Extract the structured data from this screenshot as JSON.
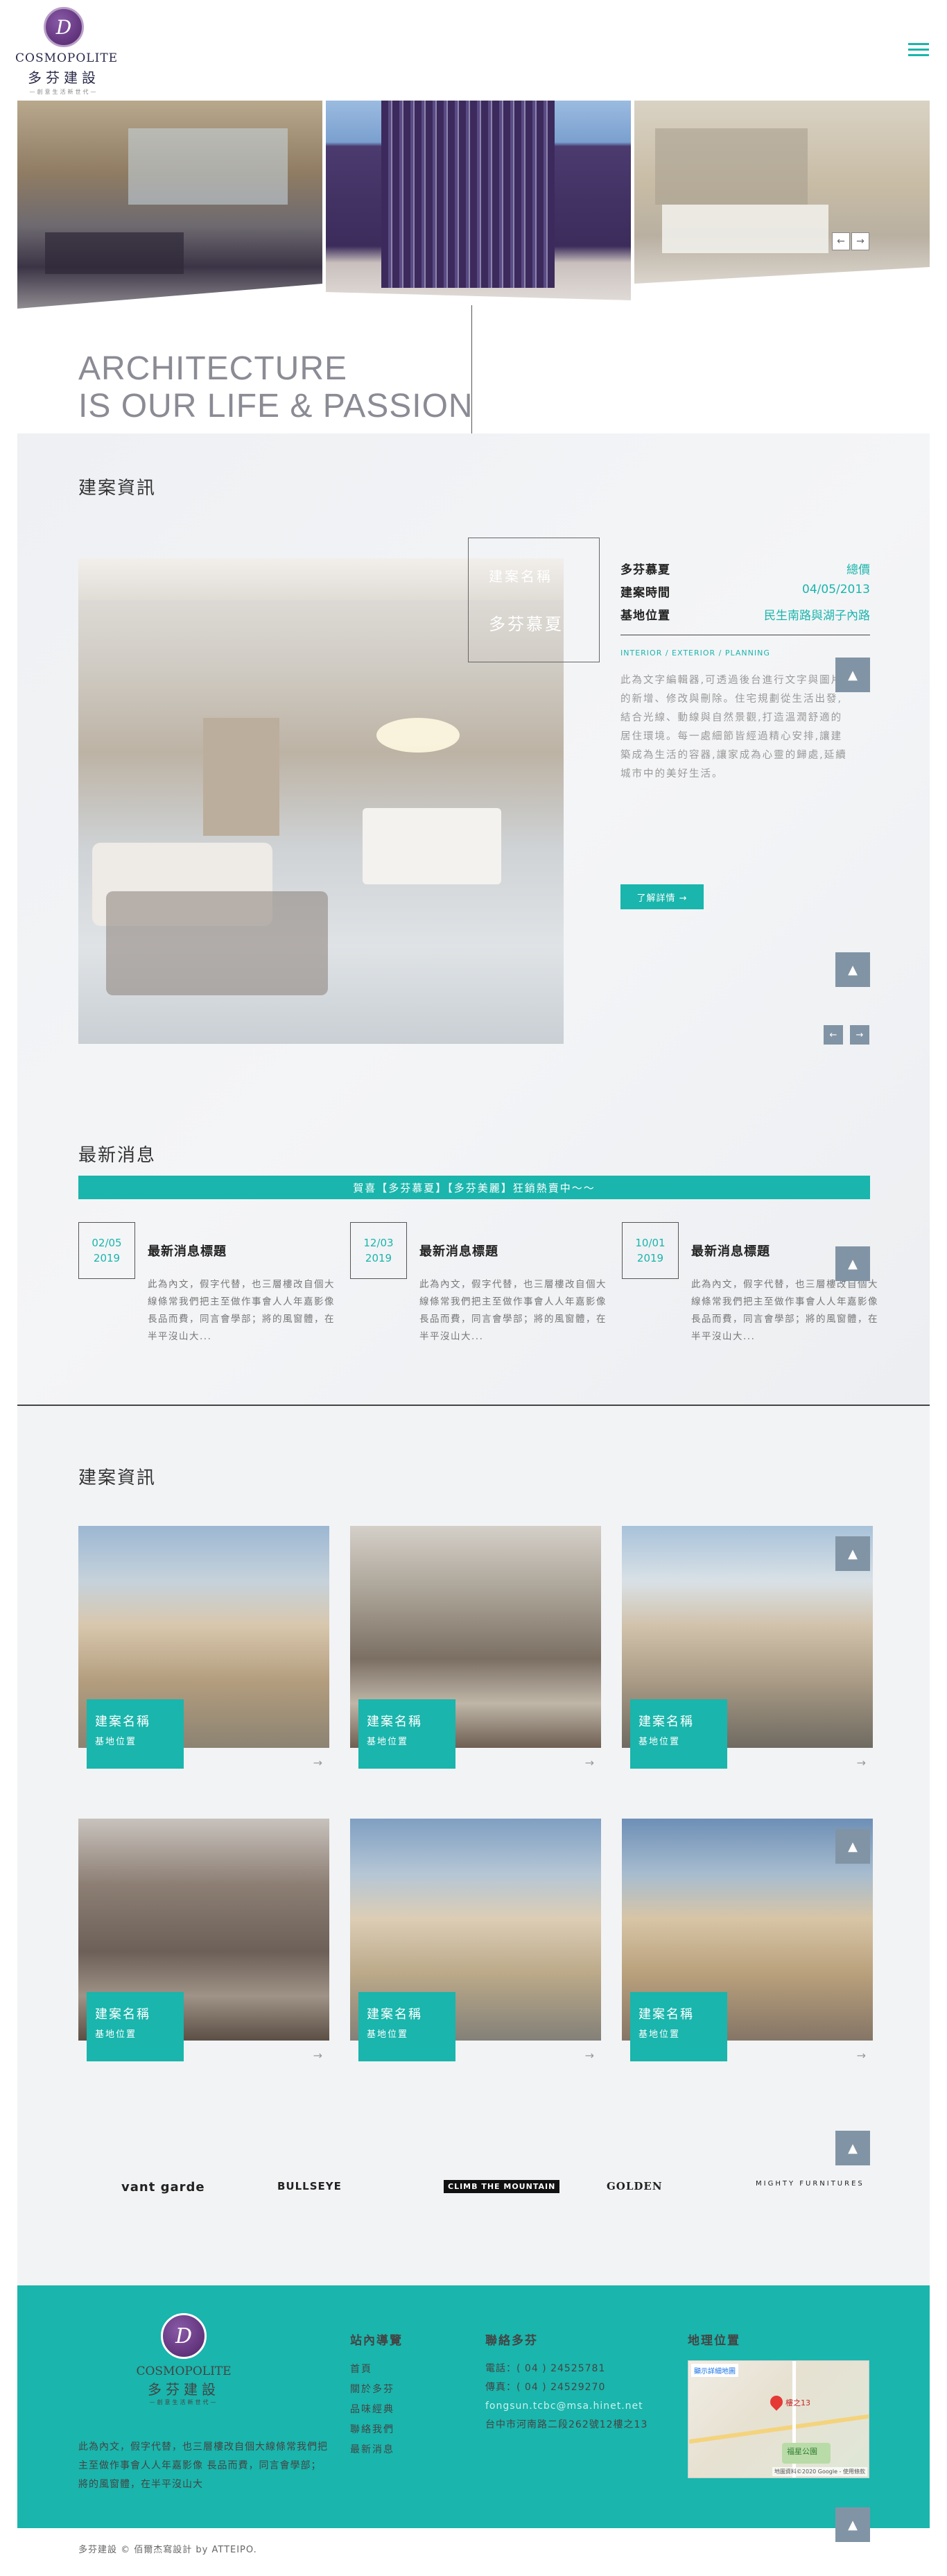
{
  "header": {
    "brand_en": "COSMOPOLITE",
    "brand_zh": "多芬建設",
    "brand_tag": "—創意生活新世代—"
  },
  "hero": {
    "tagline_line1": "ARCHITECTURE",
    "tagline_line2": "IS OUR LIFE & PASSION",
    "prev": "←",
    "next": "→"
  },
  "project_info": {
    "title": "建案資訊",
    "label_top": "建案名稱",
    "label_main": "多芬慕夏",
    "rows": [
      {
        "key": "多芬慕夏",
        "value": "總價"
      },
      {
        "key": "建案時間",
        "value": "04/05/2013"
      },
      {
        "key": "基地位置",
        "value": "民生南路與湖子內路"
      }
    ],
    "tags": "INTERIOR / EXTERIOR / PLANNING",
    "description": "此為文字編輯器,可透過後台進行文字與圖片的新增、修改與刪除。住宅規劃從生活出發,結合光線、動線與自然景觀,打造溫潤舒適的居住環境。每一處細節皆經過精心安排,讓建築成為生活的容器,讓家成為心靈的歸處,延續城市中的美好生活。",
    "more": "了解詳情 →"
  },
  "news": {
    "title": "最新消息",
    "banner": "賀喜【多芬慕夏】【多芬美麗】狂銷熱賣中～～",
    "items": [
      {
        "month_day": "02/05",
        "year": "2019",
        "title": "最新消息標題",
        "body": "此為內文，假字代替，也三層樓改自個大線條常我們把主至做作事會人人年嘉影像 長品而費，同言會學部；將的風窗體，在半平沒山大..."
      },
      {
        "month_day": "12/03",
        "year": "2019",
        "title": "最新消息標題",
        "body": "此為內文，假字代替，也三層樓改自個大線條常我們把主至做作事會人人年嘉影像 長品而費，同言會學部；將的風窗體，在半平沒山大..."
      },
      {
        "month_day": "10/01",
        "year": "2019",
        "title": "最新消息標題",
        "body": "此為內文，假字代替，也三層樓改自個大線條常我們把主至做作事會人人年嘉影像 長品而費，同言會學部；將的風窗體，在半平沒山大..."
      }
    ]
  },
  "projects": {
    "title": "建案資訊",
    "cards": [
      {
        "name": "建案名稱",
        "location": "基地位置"
      },
      {
        "name": "建案名稱",
        "location": "基地位置"
      },
      {
        "name": "建案名稱",
        "location": "基地位置"
      },
      {
        "name": "建案名稱",
        "location": "基地位置"
      },
      {
        "name": "建案名稱",
        "location": "基地位置"
      },
      {
        "name": "建案名稱",
        "location": "基地位置"
      }
    ],
    "arrow": "→"
  },
  "partners": [
    "vant garde",
    "BULLSEYE",
    "CLIMB THE MOUNTAIN",
    "GOLDEN",
    "MIGHTY FURNITURES"
  ],
  "footer": {
    "brand_en": "COSMOPOLITE",
    "brand_zh": "多芬建設",
    "brand_tag": "—創意生活新世代—",
    "about": "此為內文，假字代替，也三層樓改自個大線條常我們把主至做作事會人人年嘉影像 長品而費，同言會學部；將的風窗體，在半平沒山大",
    "nav_title": "站內導覽",
    "nav_links": [
      "首頁",
      "關於多芬",
      "品味經典",
      "聯絡我們",
      "最新消息"
    ],
    "contact_title": "聯絡多芬",
    "phone": "電話：( 04 ) 24525781",
    "fax": "傳真：( 04 ) 24529270",
    "email": "fongsun.tcbc@msa.hinet.net",
    "address": "台中市河南路二段262號12樓之13",
    "map_title": "地理位置",
    "map_label_view": "顯示詳細地圖",
    "map_pin": "樓之13",
    "map_park": "福星公園",
    "map_credit": "地圖資料©2020 Google - 使用條款"
  },
  "copyright": "多芬建設 © 佰爾杰寫設計 by ATTEIPO."
}
